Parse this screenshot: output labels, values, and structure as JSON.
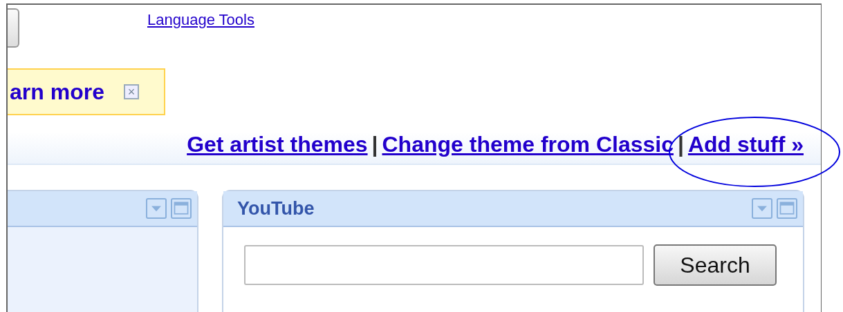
{
  "header": {
    "language_link": "Language Tools"
  },
  "notice": {
    "text": "arn more",
    "close": "×"
  },
  "links": [
    {
      "text": "Get artist themes"
    },
    {
      "text": "Change theme from Classic"
    },
    {
      "text": "Add stuff »",
      "highlighted": true
    }
  ],
  "separator": "|",
  "gadgets": [
    {
      "kind": "plain"
    },
    {
      "kind": "search",
      "title": "YouTube",
      "button": "Search"
    }
  ]
}
